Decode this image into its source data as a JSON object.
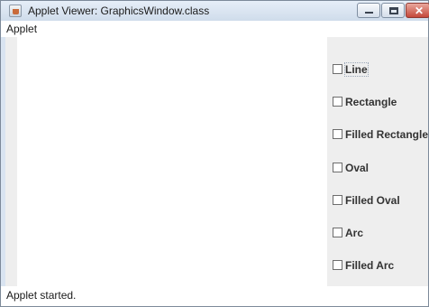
{
  "window": {
    "title": "Applet Viewer: GraphicsWindow.class",
    "icon": "java-applet-icon"
  },
  "controls": {
    "minimize_icon": "minimize-icon",
    "maximize_icon": "maximize-icon",
    "close_icon": "close-icon"
  },
  "menu": {
    "items": [
      {
        "label": "Applet"
      }
    ]
  },
  "options": [
    {
      "label": "Line",
      "checked": false
    },
    {
      "label": "Rectangle",
      "checked": false
    },
    {
      "label": "Filled Rectangle",
      "checked": false
    },
    {
      "label": "Oval",
      "checked": false
    },
    {
      "label": "Filled Oval",
      "checked": false
    },
    {
      "label": "Arc",
      "checked": false
    },
    {
      "label": "Filled Arc",
      "checked": false
    }
  ],
  "status": {
    "text": "Applet started."
  },
  "colors": {
    "title_bar": "#d9e4f1",
    "panel": "#eeeeee",
    "close_button": "#c4473a"
  }
}
